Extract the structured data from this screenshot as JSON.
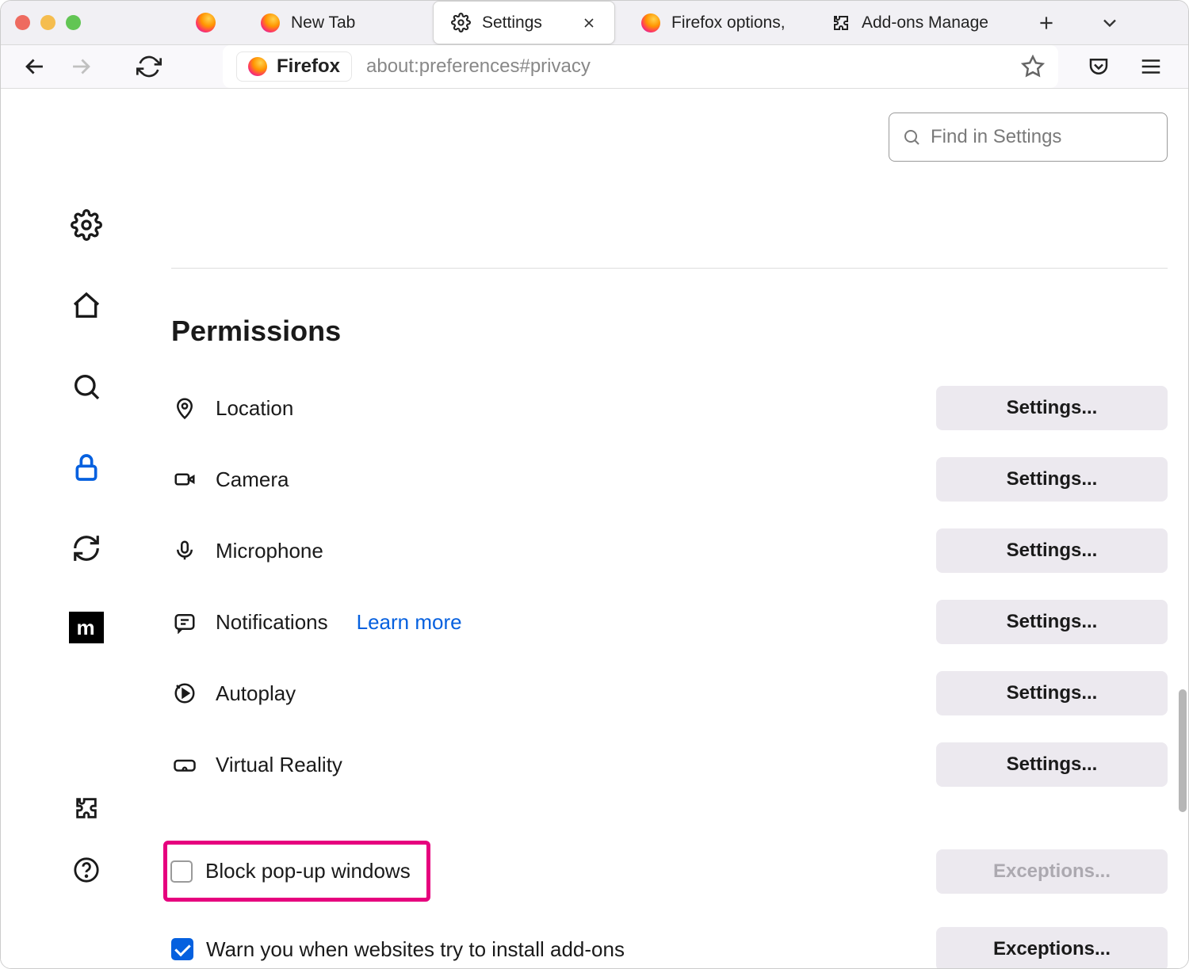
{
  "tabs": [
    {
      "label": "New Tab"
    },
    {
      "label": "Settings"
    },
    {
      "label": "Firefox options,"
    },
    {
      "label": "Add-ons Manage"
    }
  ],
  "url": {
    "identity_label": "Firefox",
    "path": "about:preferences#privacy"
  },
  "search": {
    "placeholder": "Find in Settings"
  },
  "section_title": "Permissions",
  "permissions": [
    {
      "label": "Location",
      "button": "Settings..."
    },
    {
      "label": "Camera",
      "button": "Settings..."
    },
    {
      "label": "Microphone",
      "button": "Settings..."
    },
    {
      "label": "Notifications",
      "button": "Settings...",
      "learn_more": "Learn more"
    },
    {
      "label": "Autoplay",
      "button": "Settings..."
    },
    {
      "label": "Virtual Reality",
      "button": "Settings..."
    }
  ],
  "checkboxes": {
    "block_popups": {
      "label": "Block pop-up windows",
      "checked": false,
      "button": "Exceptions...",
      "button_disabled": true
    },
    "warn_addons": {
      "label": "Warn you when websites try to install add-ons",
      "checked": true,
      "button": "Exceptions...",
      "button_disabled": false
    }
  },
  "mozilla_badge": "m"
}
